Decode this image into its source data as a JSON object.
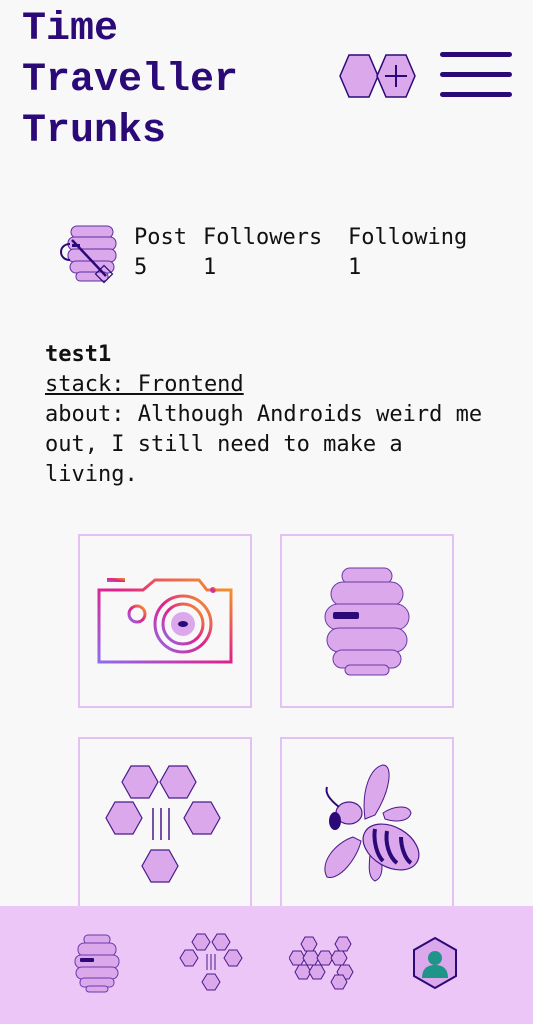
{
  "header": {
    "title_lines": [
      "Time",
      "Traveller",
      "Trunks"
    ]
  },
  "profile": {
    "stats": [
      {
        "label": "Post",
        "value": "5"
      },
      {
        "label": "Followers",
        "value": "1"
      },
      {
        "label": "Following",
        "value": "1"
      }
    ]
  },
  "bio": {
    "name": "test1",
    "stack": "stack: Frontend",
    "about": "about: Although Androids weird me out, I still need to make a living."
  },
  "tiles": [
    {
      "icon": "camera-icon"
    },
    {
      "icon": "hive-icon"
    },
    {
      "icon": "honeycomb-drip-icon"
    },
    {
      "icon": "bee-icon"
    }
  ],
  "nav": {
    "items": [
      {
        "icon": "hive-icon"
      },
      {
        "icon": "honeycomb-drip-icon"
      },
      {
        "icon": "honeycomb-cluster-icon"
      },
      {
        "icon": "profile-hex-icon"
      }
    ]
  },
  "colors": {
    "brand_dark": "#2b0a78",
    "lavender": "#dca8ec",
    "tile_border": "#e2c2f4",
    "nav_bg": "#ecc6f6",
    "teal": "#1f9488"
  }
}
